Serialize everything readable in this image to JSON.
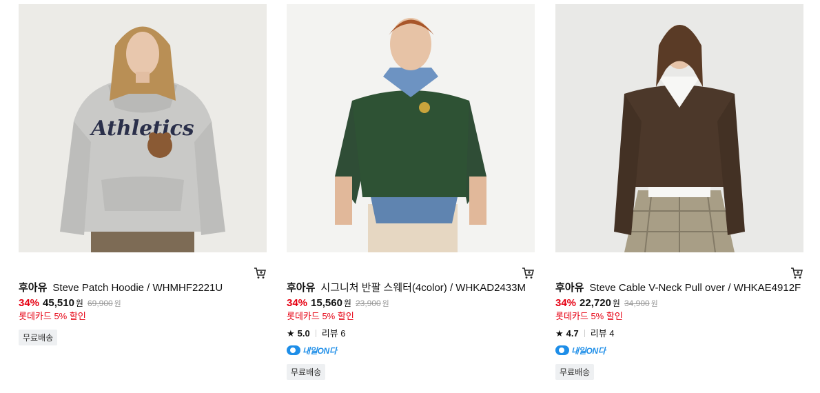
{
  "products": [
    {
      "image_alt": "Steve Patch Hoodie",
      "brand": "후아유",
      "name": "Steve Patch Hoodie / WHMHF2221U",
      "discount": "34%",
      "price": "45,510",
      "currency": "원",
      "original_price": "69,900",
      "card_promo": "롯데카드 5% 할인",
      "badge": "무료배송"
    },
    {
      "image_alt": "시그니처 반팔 스웨터",
      "brand": "후아유",
      "name": "시그니처 반팔 스웨터(4color) / WHKAD2433M",
      "discount": "34%",
      "price": "15,560",
      "currency": "원",
      "original_price": "23,900",
      "card_promo": "롯데카드 5% 할인",
      "rating": "5.0",
      "review_label": "리뷰",
      "review_count": "6",
      "delivery_label": "내일ON다",
      "badge": "무료배송"
    },
    {
      "image_alt": "Steve Cable V-Neck Pull over",
      "brand": "후아유",
      "name": "Steve Cable V-Neck Pull over / WHKAE4912F",
      "discount": "34%",
      "price": "22,720",
      "currency": "원",
      "original_price": "34,900",
      "card_promo": "롯데카드 5% 할인",
      "rating": "4.7",
      "review_label": "리뷰",
      "review_count": "4",
      "delivery_label": "내일ON다",
      "badge": "무료배송"
    }
  ],
  "icons": {
    "cart": "cart-icon",
    "star": "star-icon",
    "delivery": "delivery-badge-icon"
  },
  "colors": {
    "discount": "#e60012",
    "delivery": "#1e8ee8"
  }
}
